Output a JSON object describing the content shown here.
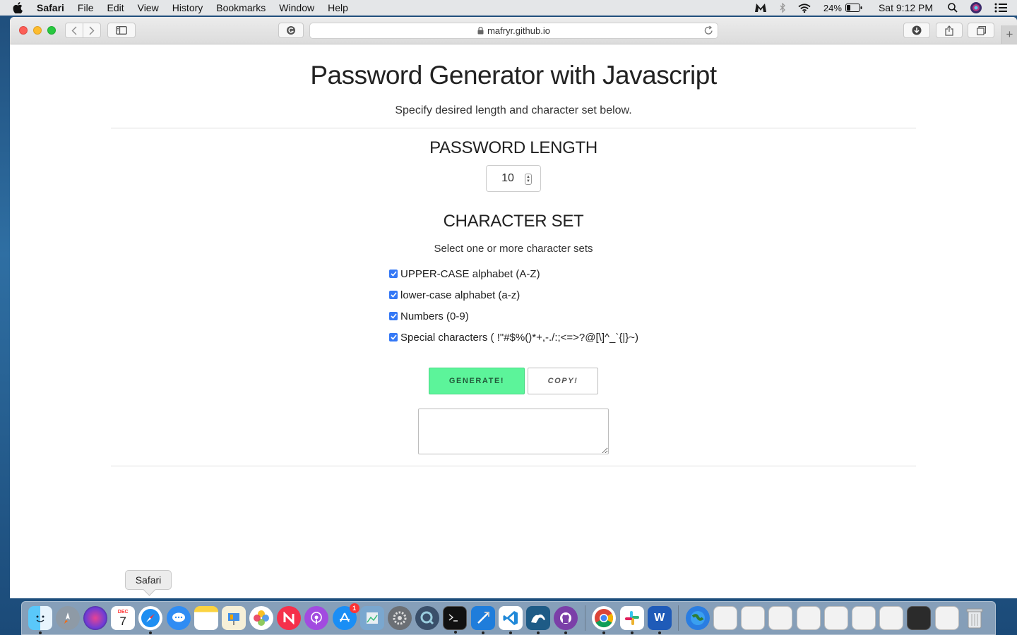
{
  "menubar": {
    "app": "Safari",
    "items": [
      "File",
      "Edit",
      "View",
      "History",
      "Bookmarks",
      "Window",
      "Help"
    ],
    "battery": "24%",
    "clock": "Sat 9:12 PM"
  },
  "browser": {
    "url": "mafryr.github.io"
  },
  "page": {
    "title": "Password Generator with Javascript",
    "subtitle": "Specify desired length and character set below.",
    "length_heading": "PASSWORD LENGTH",
    "length_value": "10",
    "charset_heading": "CHARACTER SET",
    "charset_hint": "Select one or more character sets",
    "charsets": [
      {
        "label": "UPPER-CASE alphabet (A-Z)",
        "checked": true
      },
      {
        "label": "lower-case alphabet (a-z)",
        "checked": true
      },
      {
        "label": "Numbers (0-9)",
        "checked": true
      },
      {
        "label": "Special characters ( !\"#$%()*+,-./:;<=>?@[\\]^_`{|}~)",
        "checked": true
      }
    ],
    "generate_label": "GENERATE!",
    "copy_label": "COPY!",
    "output_value": ""
  },
  "dock": {
    "tooltip": "Safari",
    "calendar_month": "DEC",
    "calendar_day": "7",
    "appstore_badge": "1",
    "word_letter": "W"
  },
  "colors": {
    "generate_bg": "#5cf49a",
    "checkbox": "#3478f6"
  }
}
